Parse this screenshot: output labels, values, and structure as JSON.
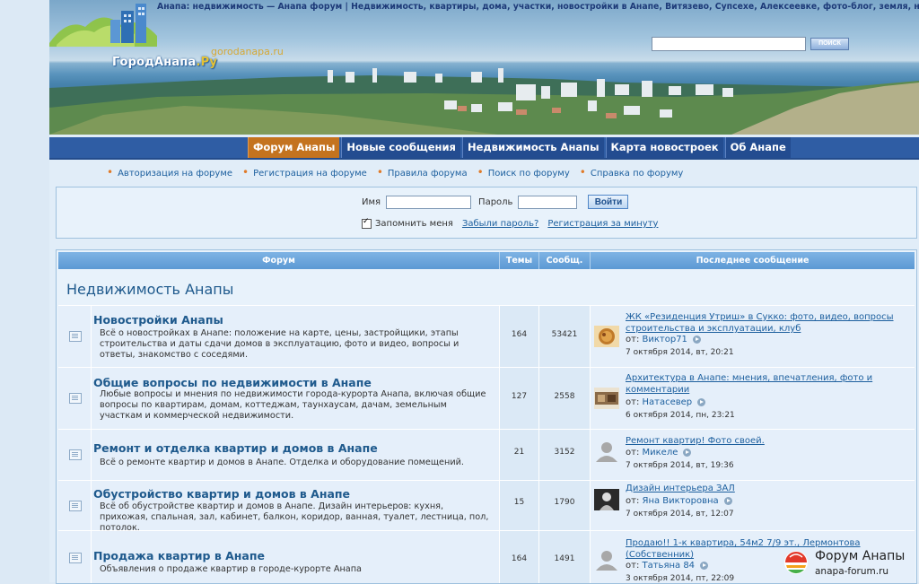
{
  "header": {
    "tagline": "Анапа: недвижимость — Анапа форум | Недвижимость, квартиры, дома, участки, новостройки в Анапе, Витязево, Супсехе, Алексеевке, фото-блог, земля, новости",
    "logo_text_main": "ГородАнапа",
    "logo_text_suffix": ".Ру",
    "domain": "gorodanapa.ru",
    "search_button": "ПОИСК",
    "search_value": ""
  },
  "nav": {
    "tabs": [
      {
        "label": "Форум Анапы",
        "active": true
      },
      {
        "label": "Новые сообщения",
        "active": false
      },
      {
        "label": "Недвижимость Анапы",
        "active": false
      },
      {
        "label": "Карта новостроек",
        "active": false
      },
      {
        "label": "Об Анапе",
        "active": false
      }
    ]
  },
  "links": [
    "Авторизация на форуме",
    "Регистрация на форуме",
    "Правила форума",
    "Поиск по форуму",
    "Справка по форуму"
  ],
  "login": {
    "username_label": "Имя",
    "password_label": "Пароль",
    "submit": "Войти",
    "remember": "Запомнить меня",
    "remember_checked": true,
    "forgot": "Забыли пароль?",
    "register": "Регистрация за минуту"
  },
  "table": {
    "columns": [
      "Форум",
      "Темы",
      "Сообщ.",
      "Последнее сообщение"
    ],
    "category": "Недвижимость Анапы",
    "by_label": "от:",
    "rows": [
      {
        "title": "Новостройки Анапы",
        "description": "Всё о новостройках в Анапе: положение на карте, цены, застройщики, этапы строительства и даты сдачи домов в эксплуатацию, фото и видео, вопросы и ответы, знакомство с соседями.",
        "topics": "164",
        "posts": "53421",
        "last_title": "ЖК «Резиденция Утриш» в Сукко: фото, видео, вопросы строительства и эксплуатации, клуб",
        "last_user": "Виктор71",
        "last_date": "7 октября 2014, вт, 20:21",
        "avatar": "food-avatar"
      },
      {
        "title": "Общие вопросы по недвижимости в Анапе",
        "description": "Любые вопросы и мнения по недвижимости города-курорта Анапа, включая общие вопросы по квартирам, домам, коттеджам, таунхаусам, дачам, земельным участкам и коммерческой недвижимости.",
        "topics": "127",
        "posts": "2558",
        "last_title": "Архитектура в Анапе: мнения, впечатления, фото и комментарии",
        "last_user": "Натасевер",
        "last_date": "6 октября 2014, пн, 23:21",
        "avatar": "photo-avatar"
      },
      {
        "title": "Ремонт и отделка квартир и домов в Анапе",
        "description": "Всё о ремонте квартир и домов в Анапе. Отделка и оборудование помещений.",
        "topics": "21",
        "posts": "3152",
        "last_title": "Ремонт квартир! Фото своей.",
        "last_user": "Микеле",
        "last_date": "7 октября 2014, вт, 19:36",
        "avatar": "default-avatar"
      },
      {
        "title": "Обустройство квартир и домов в Анапе",
        "description": "Всё об обустройстве квартир и домов в Анапе. Дизайн интерьеров: кухня, прихожая, спальная, зал, кабинет, балкон, коридор, ванная, туалет, лестница, пол, потолок.",
        "topics": "15",
        "posts": "1790",
        "last_title": "Дизайн интерьера ЗАЛ",
        "last_user": "Яна Викторовна",
        "last_date": "7 октября 2014, вт, 12:07",
        "avatar": "dark-avatar"
      },
      {
        "title": "Продажа квартир в Анапе",
        "description": "Объявления о продаже квартир в городе-курорте Анапа",
        "topics": "164",
        "posts": "1491",
        "last_title": "Продаю!! 1-к квартира, 54м2 7/9 эт., Лермонтова (Собственник)",
        "last_user": "Татьяна 84",
        "last_date": "3 октября 2014, пт, 22:09",
        "avatar": "default-avatar"
      }
    ]
  },
  "watermark": {
    "title": "Форум Анапы",
    "subtitle": "anapa-forum.ru"
  }
}
